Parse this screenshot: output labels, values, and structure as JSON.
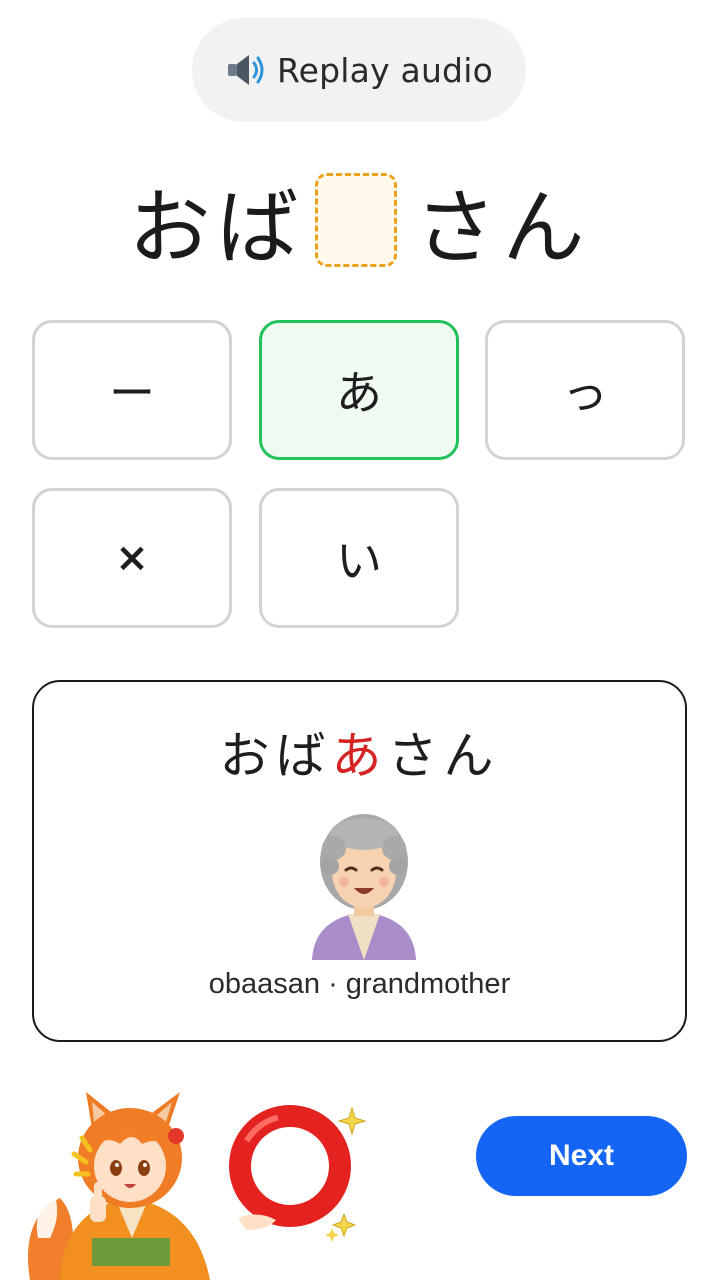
{
  "replay": {
    "icon": "speaker-icon",
    "label": "Replay audio"
  },
  "prompt": {
    "before": "おば",
    "after": "さん"
  },
  "options": [
    {
      "label": "ー",
      "selected": false
    },
    {
      "label": "あ",
      "selected": true
    },
    {
      "label": "っ",
      "selected": false
    },
    {
      "label": "×",
      "selected": false
    },
    {
      "label": "い",
      "selected": false
    }
  ],
  "answer_card": {
    "word_before": "おば",
    "word_highlight": "あ",
    "word_after": "さん",
    "highlight_color": "#d42424",
    "illustration": "grandmother-illustration",
    "meaning": "obaasan · grandmother"
  },
  "feedback": {
    "mascot": "fox-girl-mascot",
    "mark": "correct-circle-icon"
  },
  "next_button": {
    "label": "Next",
    "color": "#1565f5"
  },
  "colors": {
    "selected_border": "#22c25a",
    "blank_border": "#e9a21c"
  }
}
